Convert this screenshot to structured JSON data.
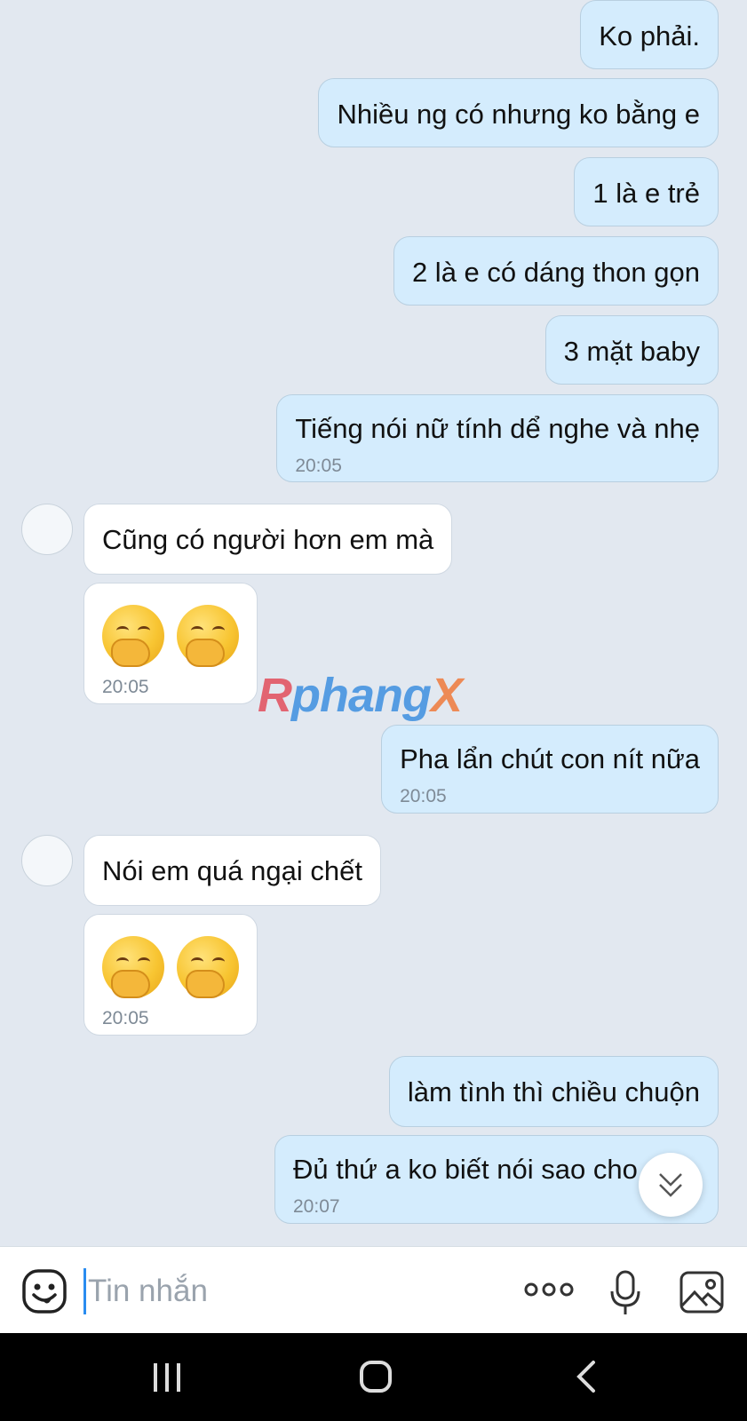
{
  "messages": [
    {
      "text": "Ko phải."
    },
    {
      "text": "Nhiều ng có nhưng ko bằng e"
    },
    {
      "text": "1 là e trẻ"
    },
    {
      "text": "2 là e có dáng thon gọn"
    },
    {
      "text": "3 mặt baby"
    },
    {
      "text": "Tiếng nói nữ tính dể nghe và nhẹ",
      "time": "20:05"
    },
    {
      "text": "Cũng có người hơn em mà"
    },
    {
      "time": "20:05"
    },
    {
      "text": "Pha lẩn chút con nít nữa",
      "time": "20:05"
    },
    {
      "text": "Nói em quá ngại chết"
    },
    {
      "time": "20:05"
    },
    {
      "text": "làm tình thì chiều chuộn"
    },
    {
      "text": "Đủ thứ a ko biết nói sao cho",
      "time": "20:07"
    }
  ],
  "watermark": {
    "a": "R",
    "b": "phang",
    "c": "X"
  },
  "composer": {
    "placeholder": "Tin nhắn"
  },
  "colors": {
    "outgoing": "#d4ecfd",
    "incoming": "#ffffff",
    "background": "#e2e8f0",
    "cursor": "#2a8cf0"
  }
}
